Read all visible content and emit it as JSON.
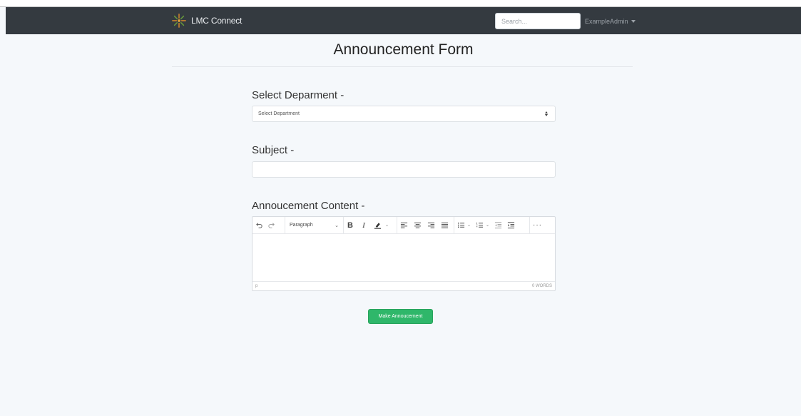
{
  "navbar": {
    "brand": "LMC Connect",
    "search_placeholder": "Search...",
    "user": "ExampleAdmin"
  },
  "page": {
    "title": "Announcement Form"
  },
  "form": {
    "department_label": "Select Deparment -",
    "department_selected": "Select Department",
    "subject_label": "Subject -",
    "subject_value": "",
    "content_label": "Annoucement Content -",
    "submit_label": "Make Annoucement"
  },
  "editor": {
    "block_format": "Paragraph",
    "bold": "B",
    "italic": "I",
    "more": "···",
    "path": "p",
    "word_count": "0 WORDS"
  },
  "colors": {
    "navbar": "#343a40",
    "submit": "#2fb76a",
    "page_bg": "#f5f8fb"
  }
}
